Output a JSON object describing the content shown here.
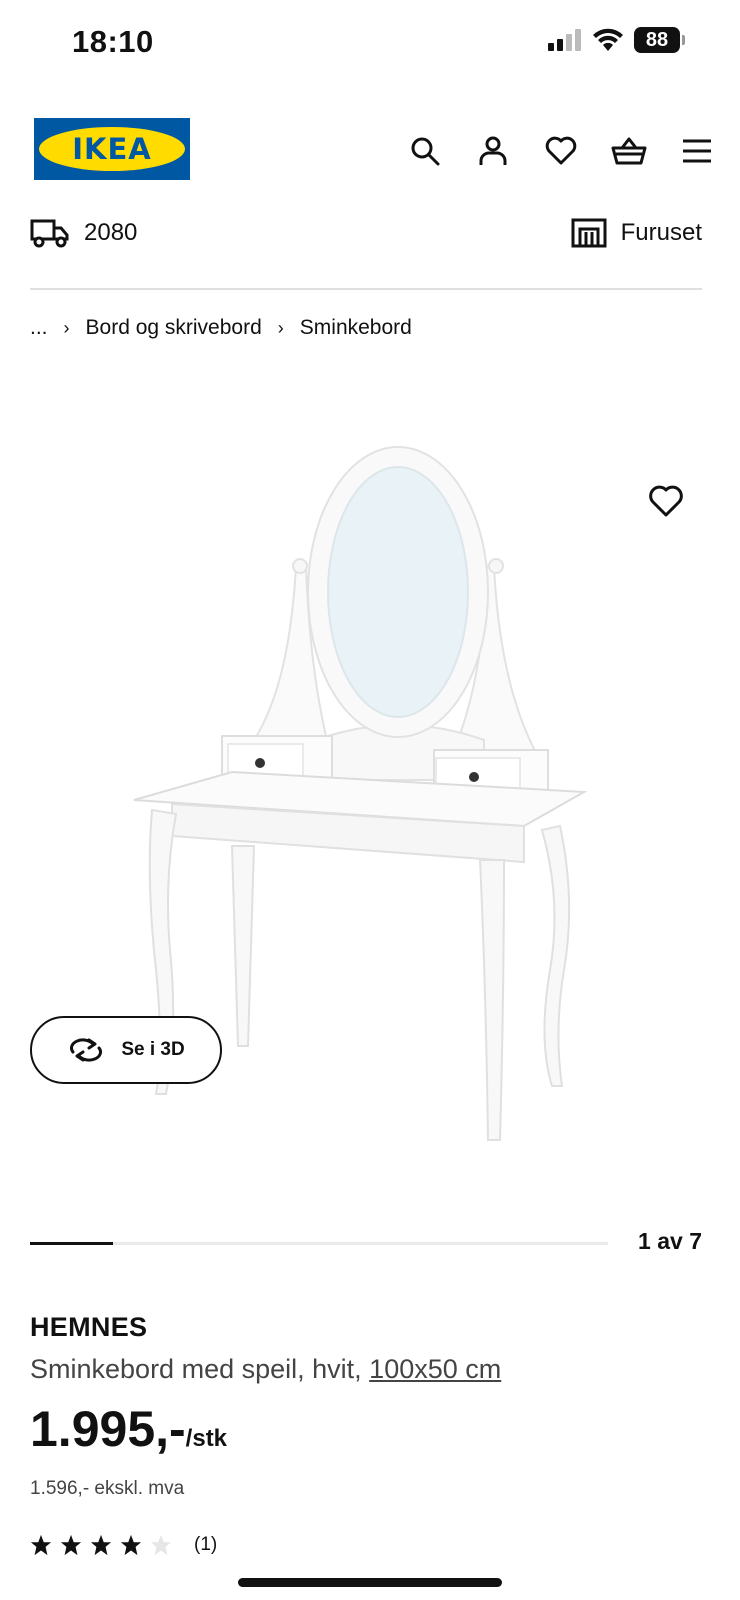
{
  "status_bar": {
    "time": "18:10",
    "battery": "88"
  },
  "header": {
    "logo_text": "IKEA",
    "icons": [
      "search-icon",
      "profile-icon",
      "heart-icon",
      "cart-icon",
      "menu-icon"
    ]
  },
  "delivery": {
    "postcode": "2080",
    "store": "Furuset"
  },
  "breadcrumb": {
    "ellipsis": "...",
    "items": [
      "Bord og skrivebord",
      "Sminkebord"
    ]
  },
  "gallery": {
    "view_3d_label": "Se i 3D",
    "counter": "1 av 7",
    "current": 1,
    "total": 7
  },
  "product": {
    "name": "HEMNES",
    "description": "Sminkebord med speil, hvit,",
    "dimensions": "100x50 cm",
    "price": "1.995,-",
    "price_unit": "/stk",
    "price_ex_vat": "1.596,- ekskl. mva",
    "rating": 4,
    "rating_max": 5,
    "review_count": "(1)"
  },
  "colors": {
    "ikea_blue": "#0058a3",
    "ikea_yellow": "#ffdb00"
  }
}
